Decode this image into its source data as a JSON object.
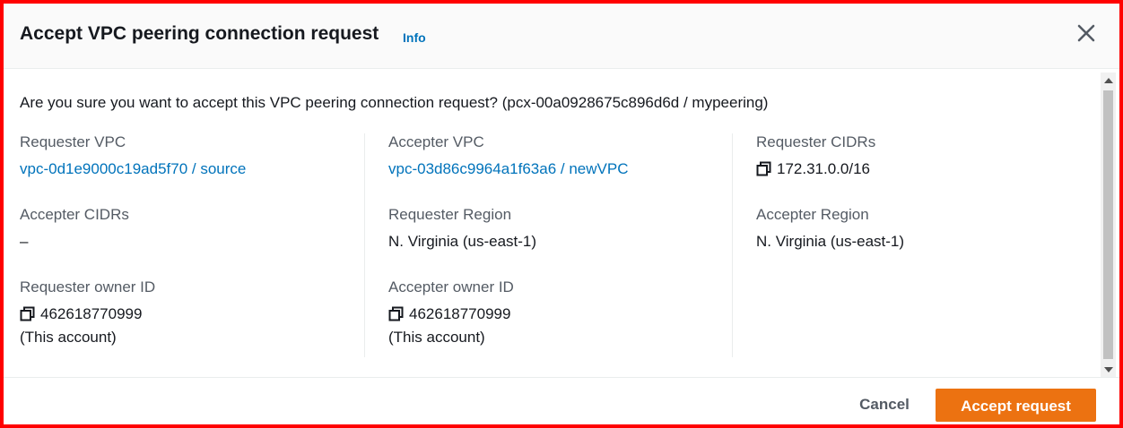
{
  "modal": {
    "title": "Accept VPC peering connection request",
    "info_label": "Info",
    "question": "Are you sure you want to accept this VPC peering connection request? (pcx-00a0928675c896d6d / mypeering)"
  },
  "fields": {
    "requester_vpc": {
      "label": "Requester VPC",
      "value": "vpc-0d1e9000c19ad5f70 / source"
    },
    "accepter_vpc": {
      "label": "Accepter VPC",
      "value": "vpc-03d86c9964a1f63a6 / newVPC"
    },
    "requester_cidrs": {
      "label": "Requester CIDRs",
      "value": "172.31.0.0/16"
    },
    "accepter_cidrs": {
      "label": "Accepter CIDRs",
      "value": "–"
    },
    "requester_region": {
      "label": "Requester Region",
      "value": "N. Virginia (us-east-1)"
    },
    "accepter_region": {
      "label": "Accepter Region",
      "value": "N. Virginia (us-east-1)"
    },
    "requester_owner": {
      "label": "Requester owner ID",
      "value": "462618770999",
      "note": "(This account)"
    },
    "accepter_owner": {
      "label": "Accepter owner ID",
      "value": "462618770999",
      "note": "(This account)"
    }
  },
  "footer": {
    "cancel_label": "Cancel",
    "accept_label": "Accept request"
  },
  "colors": {
    "accent_orange": "#ec7211",
    "link_blue": "#0073bb",
    "frame_red": "#ff0000"
  },
  "icons": {
    "close": "close-icon",
    "copy": "copy-icon"
  }
}
